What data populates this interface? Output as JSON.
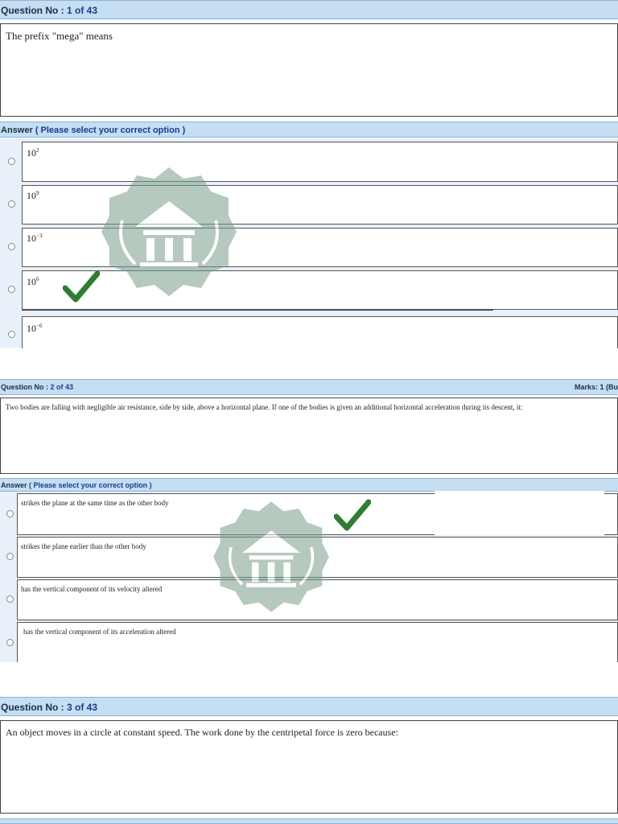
{
  "q1": {
    "header_label": "Question No : ",
    "header_num": "1 of 43",
    "text": "The prefix \"mega\" means",
    "answer_label": "Answer",
    "answer_hint": "( Please select your correct option )",
    "options": [
      {
        "base": "10",
        "exp": "2"
      },
      {
        "base": "10",
        "exp": "9"
      },
      {
        "base": "10",
        "exp": "−3"
      },
      {
        "base": "10",
        "exp": "6"
      },
      {
        "base": "10",
        "exp": "−6"
      }
    ],
    "correct_index": 3
  },
  "q2": {
    "header_label": "Question No : ",
    "header_num": "2 of 43",
    "marks": "Marks: 1 (Bu",
    "text": "Two bodies are falling with negligible air resistance, side by side, above a horizontal plane. If one of the bodies is given an additional horizontal acceleration during its descent, it:",
    "answer_label": "Answer",
    "answer_hint": "( Please select your correct option )",
    "options": [
      "strikes the plane at the same time as the other body",
      "strikes the plane earlier than the other body",
      "has the vertical component of its velocity altered",
      "has the vertical component of its acceleration altered"
    ],
    "correct_index": 0
  },
  "q3": {
    "header_label": "Question No : ",
    "header_num": "3 of 43",
    "text": "An object moves in a circle at constant speed. The work done by the centripetal force is zero because:"
  },
  "colors": {
    "header_bg": "#c5def2",
    "header_text": "#1b2f45",
    "link_blue": "#1a3b8f",
    "check_green": "#2e7d32",
    "watermark": "#7a9e8c"
  },
  "icons": {
    "check": "check-mark-icon",
    "watermark": "institution-watermark-icon",
    "radio": "radio-button"
  }
}
